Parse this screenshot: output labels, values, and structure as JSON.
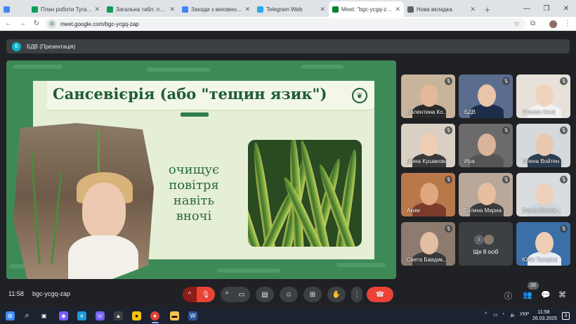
{
  "browser": {
    "tabs": [
      {
        "label": "",
        "active": false,
        "favicon_color": "#4285f4"
      },
      {
        "label": "План роботи Тугаріна К",
        "active": false,
        "favicon_color": "#0f9d58"
      },
      {
        "label": "Загальна табл. по БДВ",
        "active": false,
        "favicon_color": "#0f9d58"
      },
      {
        "label": "Заходи з виховної робо",
        "active": false,
        "favicon_color": "#4285f4"
      },
      {
        "label": "Telegram Web",
        "active": false,
        "favicon_color": "#29a9eb"
      },
      {
        "label": "Meet: \"bgc-ycgq-zap\"",
        "active": true,
        "favicon_color": "#00832d"
      },
      {
        "label": "Нова вкладка",
        "active": false,
        "favicon_color": "#5f6368"
      }
    ],
    "url": "meet.google.com/bgc-ycgq-zap"
  },
  "meeting": {
    "presenter_initial": "Б",
    "presentation_title": "БДВ (Презентація)",
    "slide": {
      "title": "Сансевієрія (або \"тещин язик\")",
      "caption_lines": [
        "очищує",
        "повітря",
        "навіть",
        "вночі"
      ]
    },
    "participants": [
      {
        "name": "Валентина Ко...",
        "muted": true
      },
      {
        "name": "БДВ",
        "muted": true
      },
      {
        "name": "Стасюк Анна",
        "muted": true
      },
      {
        "name": "Ірина Кушакова",
        "muted": true
      },
      {
        "name": "Ира",
        "muted": true
      },
      {
        "name": "Олена Войтен...",
        "muted": true
      },
      {
        "name": "Аким",
        "muted": true
      },
      {
        "name": "Галина Мирна",
        "muted": true
      },
      {
        "name": "Ольга Масюк...",
        "muted": true
      },
      {
        "name": "Света Баидик...",
        "muted": true
      },
      {
        "name": "Юлія Тугаріна",
        "muted": true
      }
    ],
    "more": {
      "label": "Ще 8 осіб",
      "avatar_initial": "І"
    },
    "time": "11:58",
    "code": "bgc-ycgq-zap",
    "participant_count": "20"
  },
  "taskbar": {
    "lang": "УКР",
    "time": "11:58",
    "date": "26.03.2025",
    "notifications": "3"
  },
  "colors": {
    "stage_green": "#3e8a57",
    "slide_bg": "#e5efd6",
    "title_green": "#1f5c34",
    "end_call_red": "#ea4335"
  }
}
